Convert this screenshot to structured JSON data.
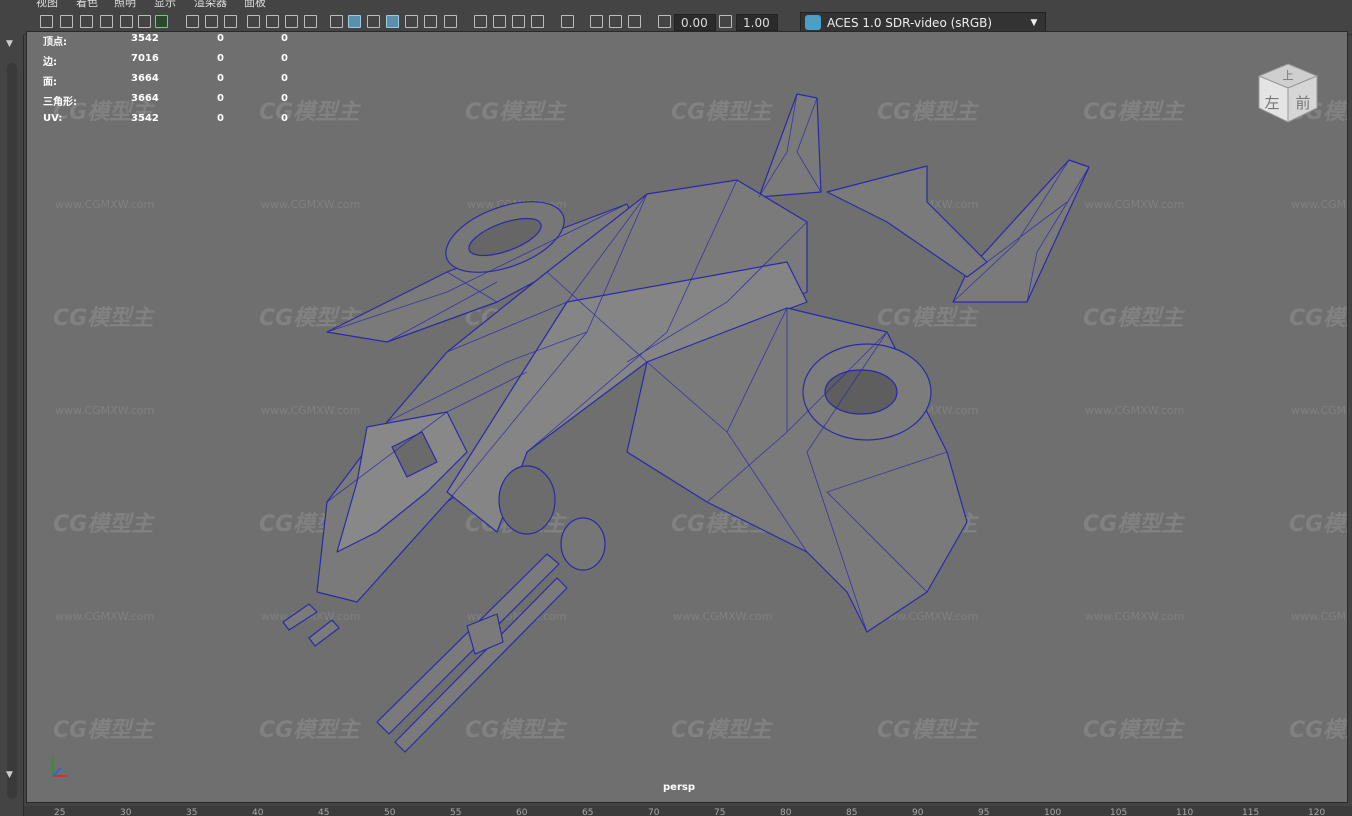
{
  "menu": {
    "items": [
      "视图",
      "着色",
      "照明",
      "显示",
      "渲染器",
      "面板"
    ]
  },
  "toolbar": {
    "exposure_value": "0.00",
    "gamma_value": "1.00",
    "colorspace": "ACES 1.0 SDR-video (sRGB)",
    "colorspace_icon": "aces-logo-icon"
  },
  "stats": {
    "rows": [
      {
        "label": "顶点:",
        "v1": "3542",
        "v2": "0",
        "v3": "0"
      },
      {
        "label": "边:",
        "v1": "7016",
        "v2": "0",
        "v3": "0"
      },
      {
        "label": "面:",
        "v1": "3664",
        "v2": "0",
        "v3": "0"
      },
      {
        "label": "三角形:",
        "v1": "3664",
        "v2": "0",
        "v3": "0"
      },
      {
        "label": "UV:",
        "v1": "3542",
        "v2": "0",
        "v3": "0"
      }
    ]
  },
  "viewcube": {
    "left": "左",
    "front": "前",
    "top": "上"
  },
  "viewport": {
    "camera": "persp"
  },
  "watermark": {
    "logo": "CG模型主",
    "url": "www.CGMXW.com"
  },
  "ruler": {
    "ticks": [
      "25",
      "30",
      "35",
      "40",
      "45",
      "50",
      "55",
      "60",
      "65",
      "70",
      "75",
      "80",
      "85",
      "90",
      "95",
      "100",
      "105",
      "110",
      "115",
      "120"
    ]
  },
  "colors": {
    "viewport_bg": "#6f6f6f",
    "wireframe": "#2a2aa8",
    "ui_bg": "#444444",
    "selected_icon": "#5a8fb0"
  }
}
